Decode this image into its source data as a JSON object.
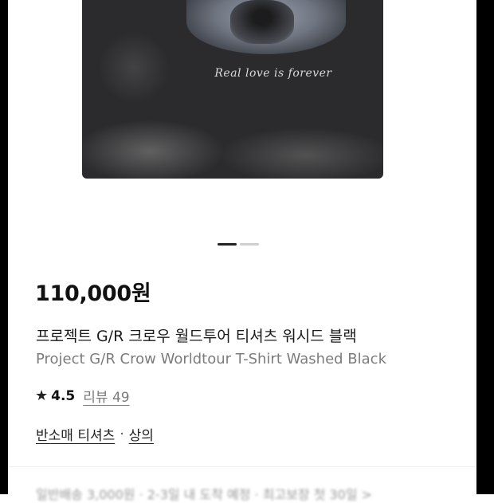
{
  "product": {
    "print_text": "Real love is forever",
    "carousel": {
      "total": 2,
      "current": 1
    },
    "price": "110,000원",
    "name_ko": "프로젝트 G/R 크로우 월드투어 티셔츠 워시드 블랙",
    "name_en": "Project G/R Crow Worldtour T-Shirt Washed Black",
    "rating": "4.5",
    "review_label": "리뷰 49",
    "category_primary": "반소매 티셔츠",
    "category_separator": "·",
    "category_secondary": "상의",
    "shipping_text": "일반배송 3,000원 · 2-3일 내 도착 예정 · 최고보장 첫 30일 >"
  },
  "icons": {
    "rating": "star-icon"
  }
}
